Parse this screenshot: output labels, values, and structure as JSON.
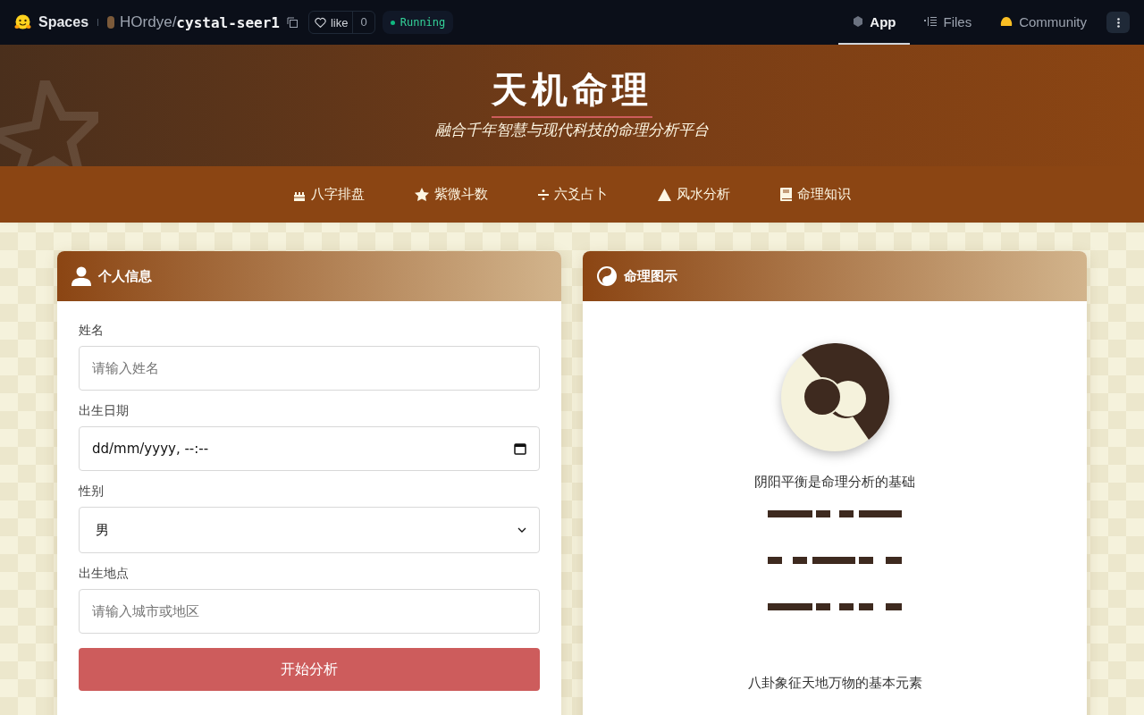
{
  "topbar": {
    "brand": "Spaces",
    "owner": "HOrdye",
    "separator": "/",
    "repo": "cystal-seer1",
    "like": "like",
    "like_count": "0",
    "status": "Running",
    "tabs": [
      {
        "label": "App",
        "selected": true,
        "kind": "app"
      },
      {
        "label": "Files",
        "selected": false,
        "kind": "files"
      },
      {
        "label": "Community",
        "selected": false,
        "kind": "community"
      }
    ]
  },
  "header": {
    "title": "天机命理",
    "subtitle": "融合千年智慧与现代科技的命理分析平台"
  },
  "nav": [
    {
      "label": "八字排盘",
      "kind": "cake"
    },
    {
      "label": "紫微斗数",
      "kind": "star"
    },
    {
      "label": "六爻占卜",
      "kind": "divide"
    },
    {
      "label": "风水分析",
      "kind": "mountain"
    },
    {
      "label": "命理知识",
      "kind": "book"
    }
  ],
  "form_card": {
    "title": "个人信息",
    "fields": [
      {
        "label": "姓名",
        "kind": "text",
        "placeholder": "请输入姓名"
      },
      {
        "label": "出生日期",
        "kind": "datetime",
        "value": "dd/mm/yyyy, --:--"
      },
      {
        "label": "性别",
        "kind": "select",
        "value": "男"
      },
      {
        "label": "出生地点",
        "kind": "text",
        "placeholder": "请输入城市或地区"
      }
    ],
    "button": "开始分析"
  },
  "chart_card": {
    "title": "命理图示",
    "yinyang_caption": "阴阳平衡是命理分析的基础",
    "bagua_caption": "八卦象征天地万物的基本元素"
  }
}
